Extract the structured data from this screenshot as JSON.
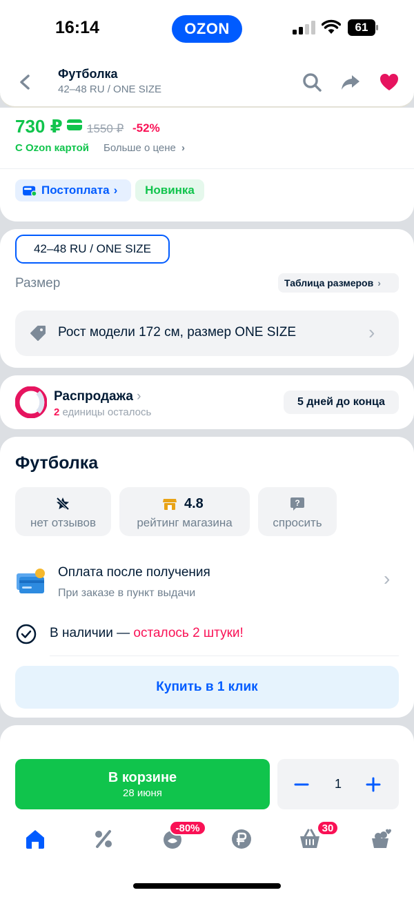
{
  "status_bar": {
    "time": "16:14",
    "app_pill": "OZON",
    "battery": "61"
  },
  "header": {
    "title": "Футболка",
    "subtitle": "42–48 RU / ONE SIZE"
  },
  "price": {
    "current": "730 ₽",
    "old": "1550 ₽",
    "discount": "-52%",
    "ozon_card": "С Ozon картой",
    "more_about_price": "Больше о цене"
  },
  "badges": {
    "postpay": "Постоплата",
    "new": "Новинка"
  },
  "size": {
    "selected": "42–48 RU / ONE SIZE",
    "label": "Размер",
    "table": "Таблица размеров",
    "model_info": "Рост модели 172 см, размер ONE SIZE"
  },
  "sale": {
    "title": "Распродажа",
    "count": "2",
    "remaining": "единицы осталось",
    "ends": "5 дней до конца"
  },
  "product": {
    "title": "Футболка",
    "stats": [
      {
        "value": "",
        "label": "нет отзывов",
        "icon": "no-star-icon"
      },
      {
        "value": "4.8",
        "label": "рейтинг магазина",
        "icon": "shop-icon"
      },
      {
        "value": "",
        "label": "спросить",
        "icon": "question-icon"
      }
    ],
    "payment_title": "Оплата после получения",
    "payment_sub": "При заказе в пункт выдачи",
    "stock_prefix": "В наличии — ",
    "stock_left": "осталось 2 штуки!",
    "buy_one_click": "Купить в 1 клик"
  },
  "cart": {
    "title": "В корзине",
    "date": "28 июня",
    "quantity": "1"
  },
  "tabbar": {
    "badges": {
      "fresh": "-80%",
      "cart": "30"
    },
    "items": [
      "home-icon",
      "percent-icon",
      "fresh-icon",
      "ruble-icon",
      "basket-icon",
      "profile-icon"
    ]
  },
  "colors": {
    "accent_blue": "#005bff",
    "price_green": "#10c44c",
    "sale_pink": "#f91155"
  }
}
